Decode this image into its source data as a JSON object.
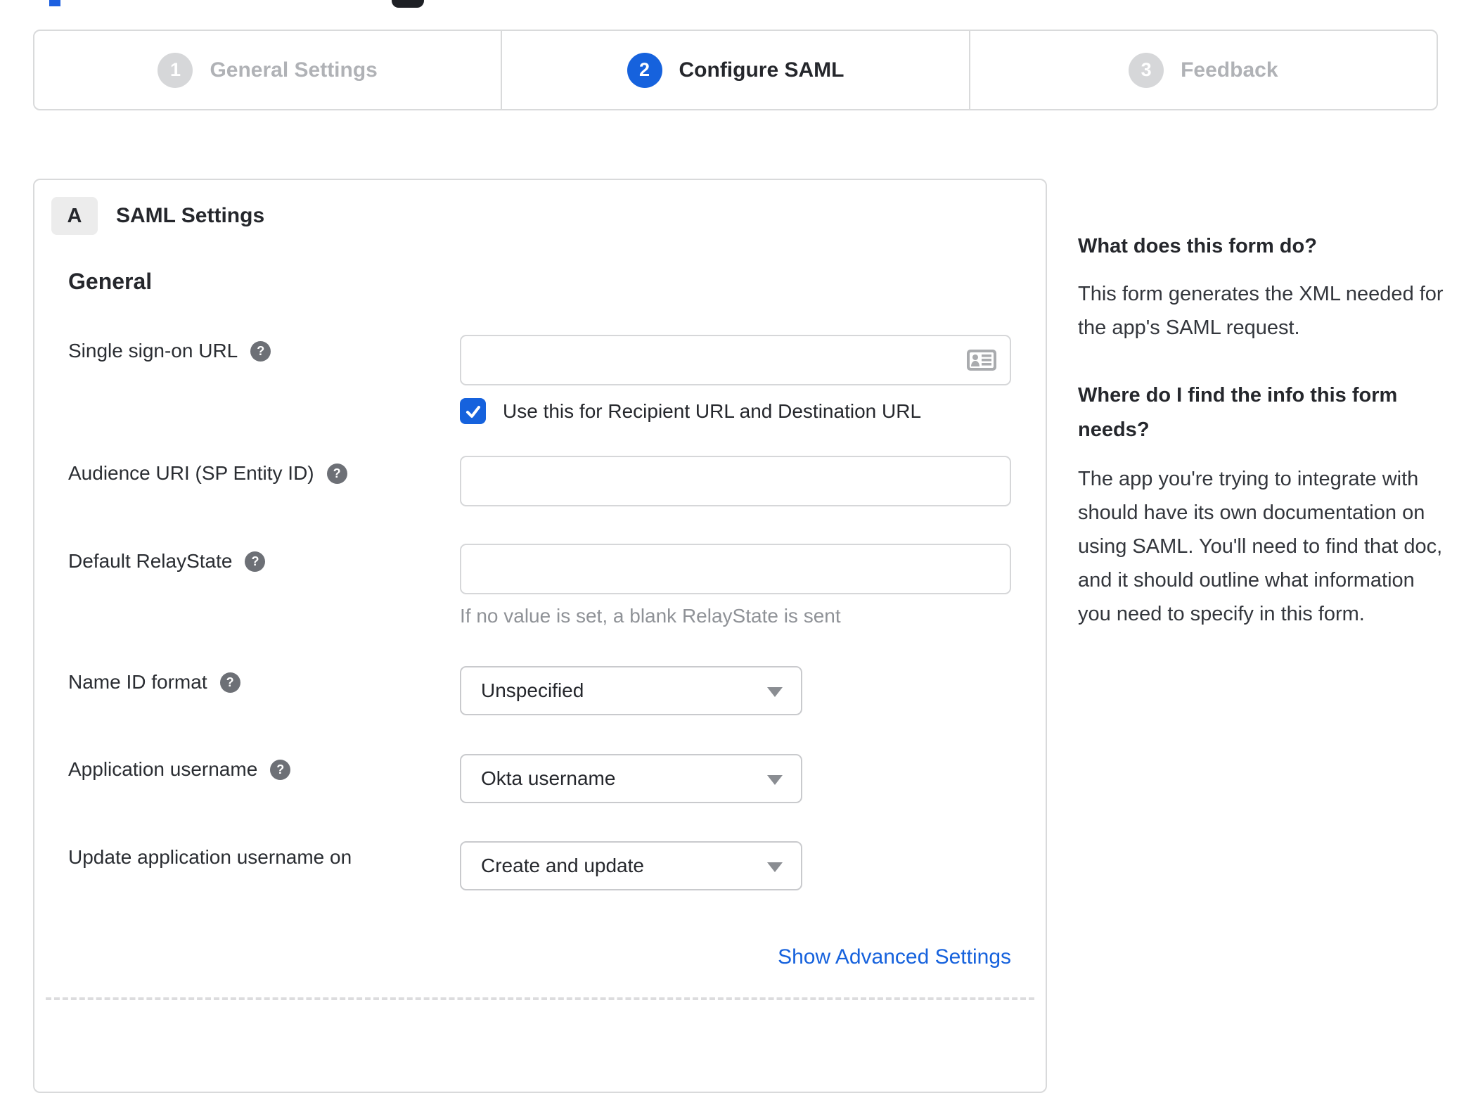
{
  "stepper": {
    "steps": [
      {
        "number": "1",
        "label": "General Settings",
        "state": "inactive"
      },
      {
        "number": "2",
        "label": "Configure SAML",
        "state": "active"
      },
      {
        "number": "3",
        "label": "Feedback",
        "state": "inactive"
      }
    ]
  },
  "panel": {
    "badge": "A",
    "title": "SAML Settings",
    "group": "General",
    "sso": {
      "label": "Single sign-on URL",
      "value": "",
      "checkbox_label": "Use this for Recipient URL and Destination URL",
      "checkbox_checked": true
    },
    "audience": {
      "label": "Audience URI (SP Entity ID)",
      "value": ""
    },
    "relay": {
      "label": "Default RelayState",
      "value": "",
      "helper": "If no value is set, a blank RelayState is sent"
    },
    "name_id": {
      "label": "Name ID format",
      "value": "Unspecified"
    },
    "app_username": {
      "label": "Application username",
      "value": "Okta username"
    },
    "update_username": {
      "label": "Update application username on",
      "value": "Create and update"
    },
    "advanced_link": "Show Advanced Settings"
  },
  "sidebar": {
    "q1": "What does this form do?",
    "a1": "This form generates the XML needed for the app's SAML request.",
    "q2": "Where do I find the info this form needs?",
    "a2": "The app you're trying to integrate with should have its own documentation on using SAML. You'll need to find that doc, and it should outline what information you need to specify in this form."
  },
  "icons": {
    "help": "question-mark-circle",
    "card": "contact-card",
    "check": "checkmark",
    "dropdown": "triangle-down"
  },
  "colors": {
    "accent": "#1662dd",
    "border": "#d9dadb",
    "text": "#25272c",
    "muted": "#8f9297",
    "step_inactive": "#d6d7d9"
  }
}
